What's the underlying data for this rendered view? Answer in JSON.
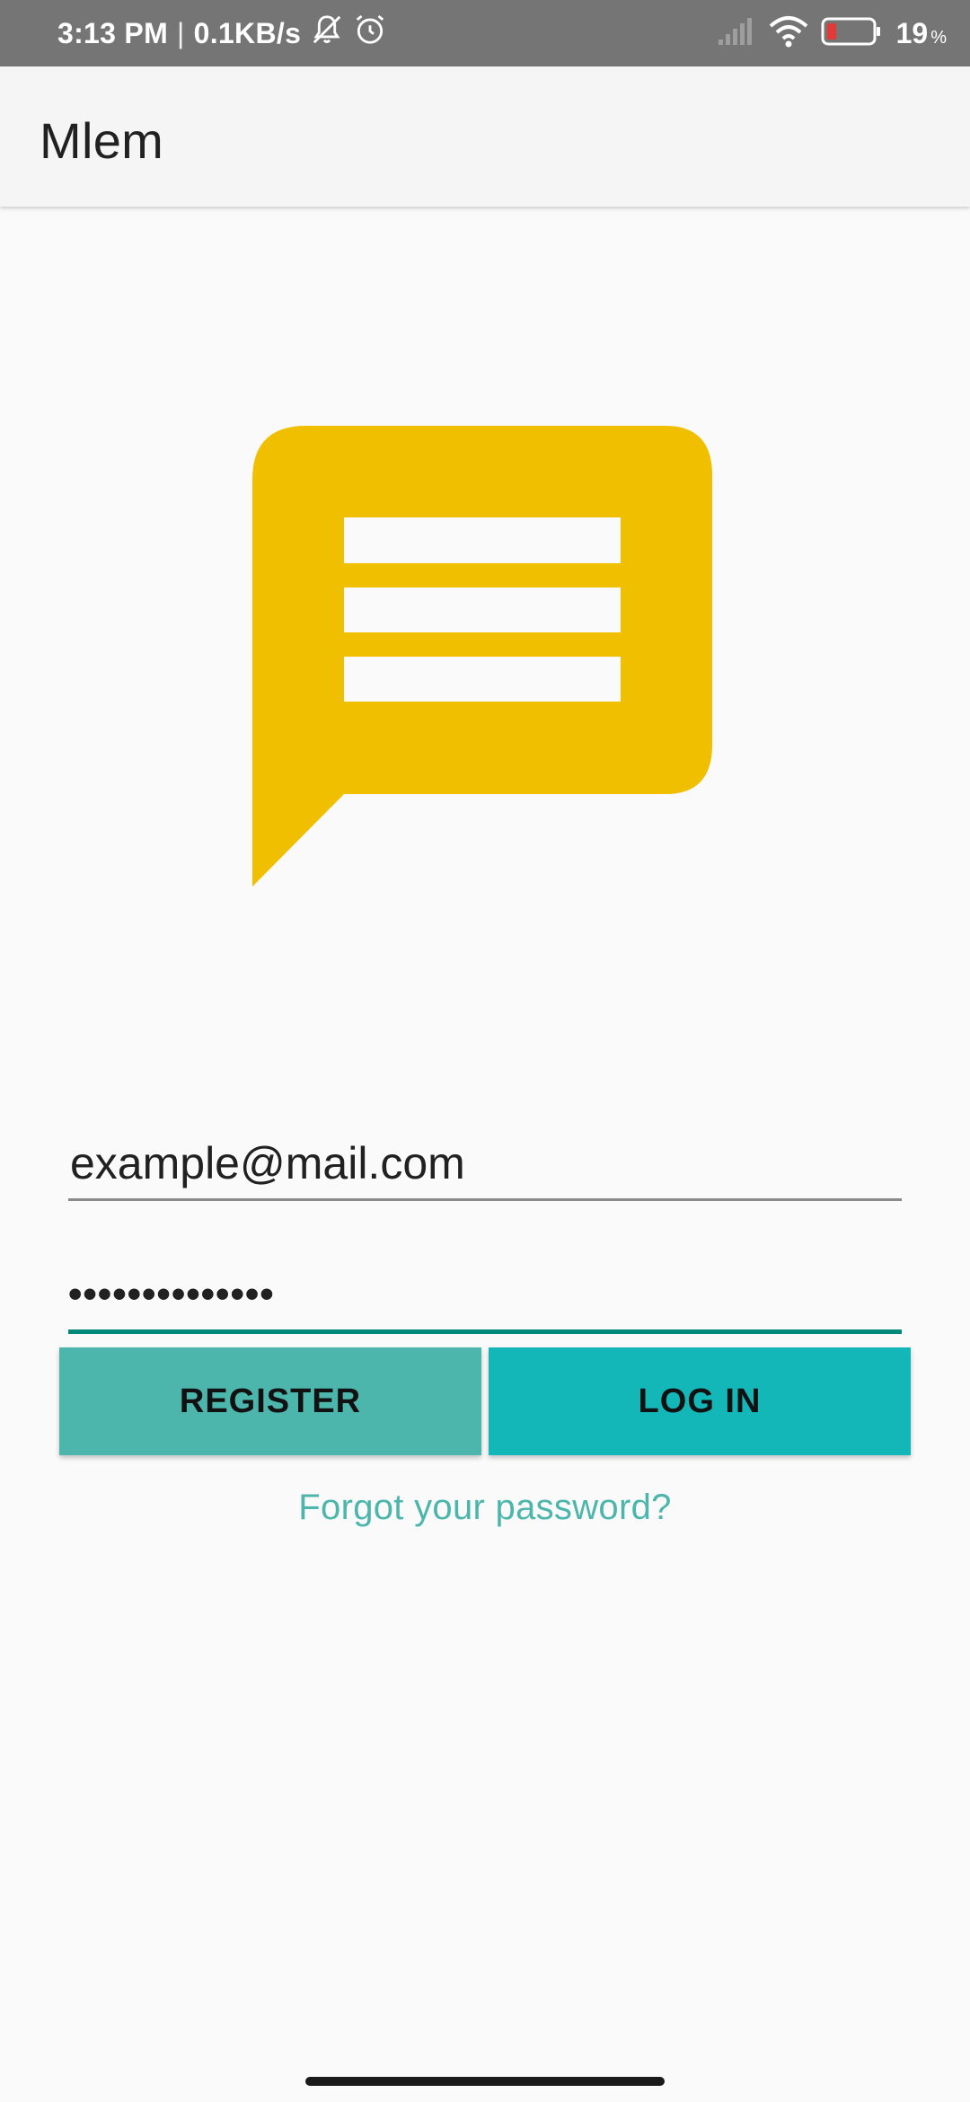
{
  "status_bar": {
    "time": "3:13 PM",
    "separator": "|",
    "network_speed": "0.1KB/s",
    "icons": [
      "notifications-off-icon",
      "alarm-icon",
      "signal-icon",
      "wifi-icon",
      "battery-icon"
    ],
    "battery_level": "19",
    "battery_unit": "%"
  },
  "app_bar": {
    "title": "Mlem"
  },
  "logo": {
    "icon": "chat-message-icon",
    "color": "#f0c000"
  },
  "login_form": {
    "email_value": "example@mail.com",
    "password_value": "••••••••••••••",
    "register_label": "REGISTER",
    "login_label": "LOG IN",
    "forgot_password_label": "Forgot your password?"
  },
  "colors": {
    "register_button": "#4db6ac",
    "login_button": "#13b7b7",
    "accent": "#00897b",
    "link": "#4db6ac"
  }
}
